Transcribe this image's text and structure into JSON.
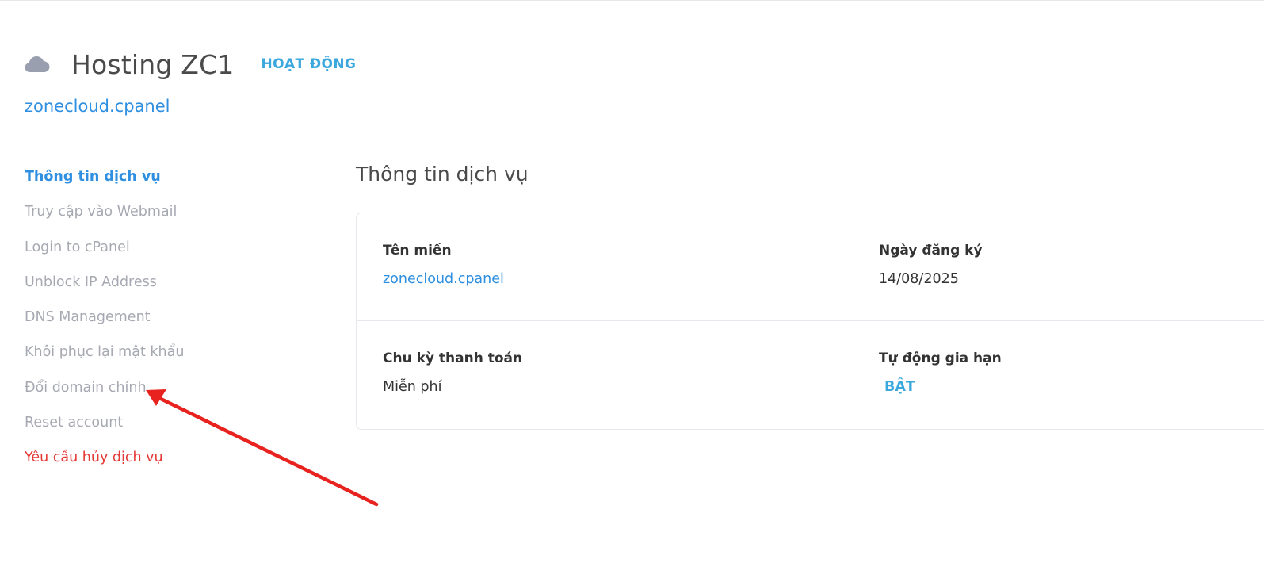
{
  "header": {
    "icon": "cloud-icon",
    "title": "Hosting ZC1",
    "status": "HOẠT ĐỘNG",
    "domain": "zonecloud.cpanel"
  },
  "sidebar": {
    "items": [
      {
        "label": "Thông tin dịch vụ",
        "state": "active"
      },
      {
        "label": "Truy cập vào Webmail"
      },
      {
        "label": "Login to cPanel"
      },
      {
        "label": "Unblock IP Address"
      },
      {
        "label": "DNS Management"
      },
      {
        "label": "Khôi phục lại mật khẩu"
      },
      {
        "label": "Đổi domain chính"
      },
      {
        "label": "Reset account"
      },
      {
        "label": "Yêu cầu hủy dịch vụ",
        "state": "danger"
      }
    ]
  },
  "main": {
    "section_title": "Thông tin dịch vụ",
    "fields": {
      "domain": {
        "label": "Tên miền",
        "value": "zonecloud.cpanel"
      },
      "registered": {
        "label": "Ngày đăng ký",
        "value": "14/08/2025"
      },
      "billing_cycle": {
        "label": "Chu kỳ thanh toán",
        "value": "Miễn phí"
      },
      "auto_renew": {
        "label": "Tự động gia hạn",
        "value": "BẬT"
      }
    }
  },
  "colors": {
    "accent": "#2f8fe0",
    "status": "#3aa7dd",
    "danger": "#e53935",
    "muted": "#a7a9b2",
    "annotation_arrow": "#e8231f"
  }
}
